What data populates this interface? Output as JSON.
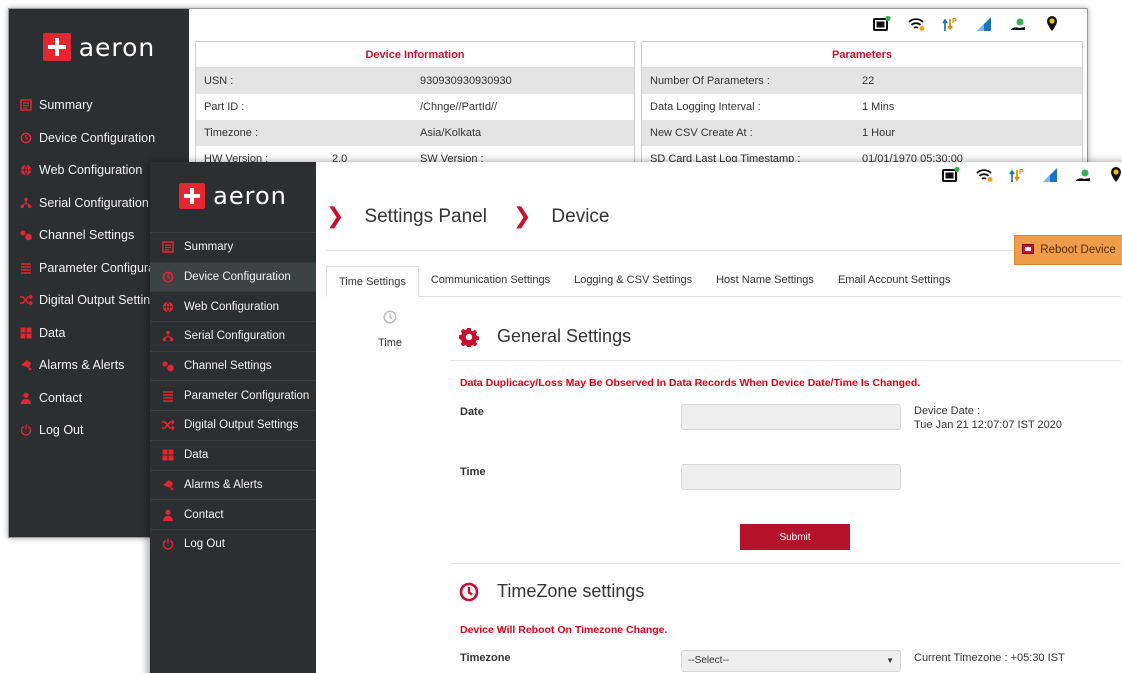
{
  "brand": {
    "name": "aeron",
    "accent": "#e3262f",
    "sidebar_bg": "#2b2f31"
  },
  "back_window": {
    "nav": [
      {
        "label": "Summary",
        "icon": "summary-icon"
      },
      {
        "label": "Device Configuration",
        "icon": "device-config-icon"
      },
      {
        "label": "Web Configuration",
        "icon": "globe-icon"
      },
      {
        "label": "Serial Configuration",
        "icon": "serial-icon"
      },
      {
        "label": "Channel Settings",
        "icon": "channel-icon"
      },
      {
        "label": "Parameter Configurati",
        "icon": "list-icon"
      },
      {
        "label": "Digital Output Settings",
        "icon": "shuffle-icon"
      },
      {
        "label": "Data",
        "icon": "grid-icon"
      },
      {
        "label": "Alarms & Alerts",
        "icon": "bell-icon"
      },
      {
        "label": "Contact",
        "icon": "person-icon"
      },
      {
        "label": "Log Out",
        "icon": "power-icon"
      }
    ],
    "device_info": {
      "title": "Device Information",
      "rows": [
        {
          "key": "USN :",
          "value": "930930930930930"
        },
        {
          "key": "Part ID :",
          "value": "/Chnge//PartId//"
        },
        {
          "key": "Timezone :",
          "value": "Asia/Kolkata"
        },
        {
          "key": "HW Version :",
          "value": "2.0",
          "key2": "SW Version :"
        }
      ]
    },
    "parameters": {
      "title": "Parameters",
      "rows": [
        {
          "key": "Number Of Parameters :",
          "value": "22"
        },
        {
          "key": "Data Logging Interval :",
          "value": "1 Mins"
        },
        {
          "key": "New CSV Create At :",
          "value": "1 Hour"
        },
        {
          "key": "SD Card Last Log Timestamp :",
          "value": "01/01/1970 05:30:00"
        }
      ]
    }
  },
  "front_window": {
    "nav": [
      {
        "label": "Summary",
        "icon": "summary-icon"
      },
      {
        "label": "Device Configuration",
        "icon": "device-config-icon",
        "active": true
      },
      {
        "label": "Web Configuration",
        "icon": "globe-icon"
      },
      {
        "label": "Serial Configuration",
        "icon": "serial-icon"
      },
      {
        "label": "Channel Settings",
        "icon": "channel-icon"
      },
      {
        "label": "Parameter Configuration",
        "icon": "list-icon"
      },
      {
        "label": "Digital Output Settings",
        "icon": "shuffle-icon"
      },
      {
        "label": "Data",
        "icon": "grid-icon"
      },
      {
        "label": "Alarms & Alerts",
        "icon": "bell-icon"
      },
      {
        "label": "Contact",
        "icon": "person-icon"
      },
      {
        "label": "Log Out",
        "icon": "power-icon"
      }
    ],
    "breadcrumb": {
      "first": "Settings Panel",
      "second": "Device"
    },
    "reboot_label": "Reboot Device",
    "tabs": [
      {
        "label": "Time Settings",
        "active": true
      },
      {
        "label": "Communication Settings"
      },
      {
        "label": "Logging & CSV Settings"
      },
      {
        "label": "Host Name Settings"
      },
      {
        "label": "Email Account Settings"
      }
    ],
    "subnav_label": "Time",
    "general": {
      "title": "General Settings",
      "warning": "Data Duplicacy/Loss May Be Observed In Data Records When Device Date/Time Is Changed.",
      "date_label": "Date",
      "date_value": "",
      "device_date_label": "Device Date :",
      "device_date_value": "Tue Jan 21 12:07:07 IST 2020",
      "time_label": "Time",
      "time_value": "",
      "submit_label": "Submit"
    },
    "timezone": {
      "title": "TimeZone settings",
      "warning": "Device Will Reboot On Timezone Change.",
      "label": "Timezone",
      "select_value": "--Select--",
      "current": "Current Timezone : +05:30 IST"
    }
  },
  "status_icons": [
    "battery-icon",
    "wifi-icon",
    "signal-arrows-icon",
    "cellular-signal-icon",
    "cloud-hand-icon",
    "location-pin-icon"
  ]
}
